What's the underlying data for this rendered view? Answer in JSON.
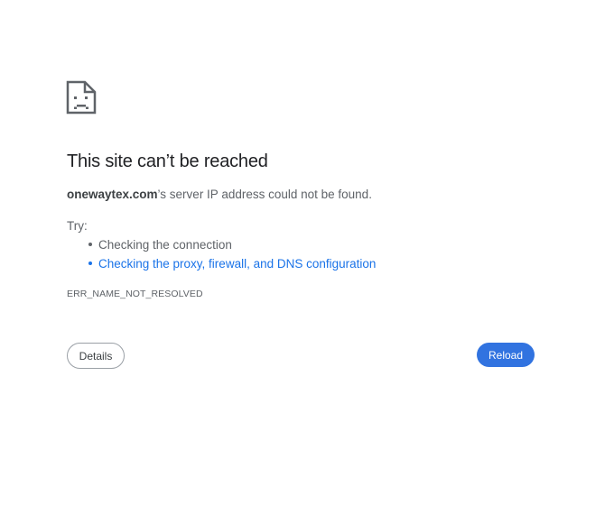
{
  "icon": "sad-page-icon",
  "title": "This site can’t be reached",
  "summary": {
    "host": "onewaytex.com",
    "message": "’s server IP address could not be found."
  },
  "try_label": "Try:",
  "suggestions": [
    {
      "label": "Checking the connection",
      "is_link": false
    },
    {
      "label": "Checking the proxy, firewall, and DNS configuration",
      "is_link": true
    }
  ],
  "error_code": "ERR_NAME_NOT_RESOLVED",
  "buttons": {
    "details_label": "Details",
    "reload_label": "Reload"
  },
  "colors": {
    "link": "#1a73e8",
    "primary_button": "#3173e0",
    "text": "#202124",
    "secondary_text": "#5f6368"
  }
}
